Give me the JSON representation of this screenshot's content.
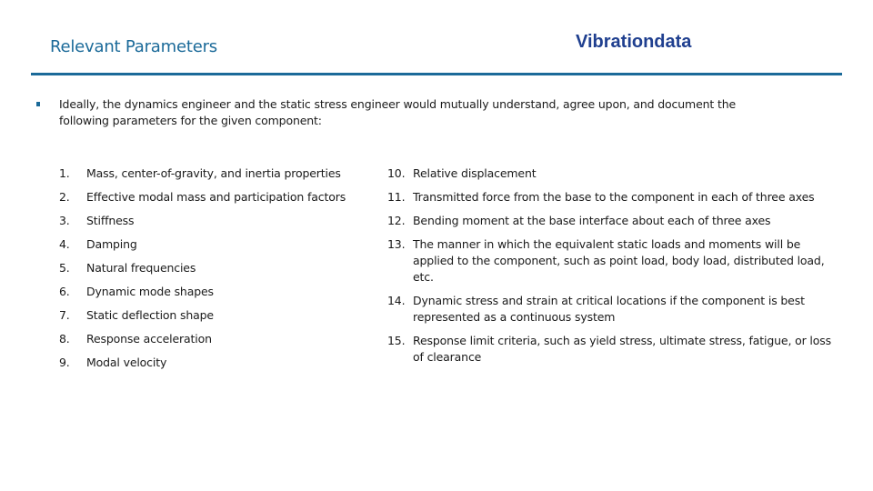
{
  "header": {
    "title": "Relevant Parameters",
    "brand": "Vibrationdata",
    "colors": {
      "title": "#1b6a99",
      "brand": "#1f3f8f",
      "rule": "#1b6a99"
    }
  },
  "intro": {
    "text": "Ideally, the dynamics engineer and the static stress engineer would mutually understand, agree upon, and document the following parameters for the given component:"
  },
  "list_left": [
    {
      "num": "1.",
      "text": "Mass, center-of-gravity, and inertia properties"
    },
    {
      "num": "2.",
      "text": "Effective modal mass and participation factors"
    },
    {
      "num": "3.",
      "text": "Stiffness"
    },
    {
      "num": "4.",
      "text": "Damping"
    },
    {
      "num": "5.",
      "text": "Natural frequencies"
    },
    {
      "num": "6.",
      "text": "Dynamic mode shapes"
    },
    {
      "num": "7.",
      "text": "Static deflection shape"
    },
    {
      "num": "8.",
      "text": "Response acceleration"
    },
    {
      "num": "9.",
      "text": "Modal velocity"
    }
  ],
  "list_right": [
    {
      "num": "10.",
      "text": " Relative displacement"
    },
    {
      "num": "11.",
      "text": "Transmitted force from the base to the component in each of three axes"
    },
    {
      "num": "12.",
      "text": "Bending moment at the base interface about each of three axes"
    },
    {
      "num": "13.",
      "text": "The manner in which the equivalent static loads and moments will be applied to the component, such as point load, body load, distributed load, etc."
    },
    {
      "num": "14.",
      "text": "Dynamic stress and strain at critical locations if the component is best represented as a continuous system"
    },
    {
      "num": "15.",
      "text": "Response limit criteria, such as yield stress, ultimate stress, fatigue, or loss of clearance"
    }
  ]
}
